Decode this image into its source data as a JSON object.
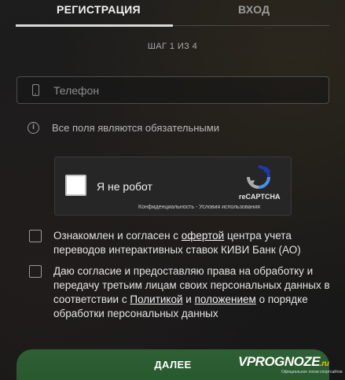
{
  "tabs": {
    "register": "РЕГИСТРАЦИЯ",
    "login": "ВХОД"
  },
  "step": "ШАГ 1 ИЗ 4",
  "phone": {
    "placeholder": "Телефон",
    "value": ""
  },
  "notice": "Все поля являются обязательными",
  "recaptcha": {
    "label": "Я не робот",
    "brand": "reCAPTCHA",
    "links": "Конфиденциальность - Условия использования"
  },
  "agreements": {
    "offer": {
      "before": "Ознакомлен и согласен с ",
      "link": "офертой",
      "after": " центра учета переводов интерактивных ставок КИВИ Банк (АО)"
    },
    "consent": {
      "before": "Даю согласие и предоставляю права на обработку и передачу третьим лицам своих персональных данных в соответствии с ",
      "link1": "Политикой",
      "middle": " и ",
      "link2": "положением",
      "after": " о порядке обработки персональных данных"
    }
  },
  "submit_label": "ДАЛЕЕ",
  "watermark": {
    "main": "VPROGNOZE",
    "suffix": ".ru",
    "sub": "Официальное логии спортсайтов"
  },
  "colors": {
    "button": "#2f5f34",
    "background": "#1a1a1a",
    "recaptcha_blue": "#1c3aa9"
  }
}
